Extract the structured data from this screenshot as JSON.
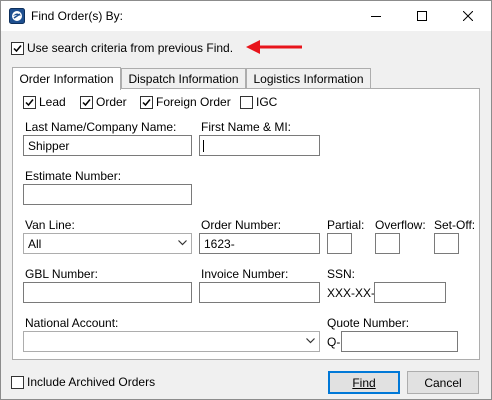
{
  "window": {
    "title": "Find Order(s) By:",
    "controls": {
      "minimize": "minimize",
      "maximize": "maximize",
      "close": "close"
    }
  },
  "previous_find": {
    "label": "Use search criteria from previous Find.",
    "checked": true,
    "arrow_color": "#e8141b"
  },
  "tabs": [
    {
      "label": "Order Information",
      "active": true
    },
    {
      "label": "Dispatch Information",
      "active": false
    },
    {
      "label": "Logistics Information",
      "active": false
    }
  ],
  "order_info": {
    "type_checks": [
      {
        "label": "Lead",
        "checked": true
      },
      {
        "label": "Order",
        "checked": true
      },
      {
        "label": "Foreign Order",
        "checked": true
      },
      {
        "label": "IGC",
        "checked": false
      }
    ],
    "last_name": {
      "label": "Last Name/Company Name:",
      "value": "Shipper"
    },
    "first_name": {
      "label": "First Name & MI:",
      "value": ""
    },
    "estimate_number": {
      "label": "Estimate Number:",
      "value": ""
    },
    "van_line": {
      "label": "Van Line:",
      "value": "All"
    },
    "order_number": {
      "label": "Order Number:",
      "value": "1623-"
    },
    "partial": {
      "label": "Partial:",
      "value": ""
    },
    "overflow": {
      "label": "Overflow:",
      "value": ""
    },
    "set_off": {
      "label": "Set-Off:",
      "value": ""
    },
    "gbl_number": {
      "label": "GBL Number:",
      "value": ""
    },
    "invoice_number": {
      "label": "Invoice Number:",
      "value": ""
    },
    "ssn": {
      "label": "SSN:",
      "prefix": "XXX-XX-",
      "value": ""
    },
    "national_account": {
      "label": "National Account:",
      "value": ""
    },
    "quote_number": {
      "label": "Quote Number:",
      "prefix": "Q-",
      "value": ""
    }
  },
  "footer": {
    "include_archived": {
      "label": "Include Archived Orders",
      "checked": false
    },
    "find_label": "Find",
    "cancel_label": "Cancel"
  }
}
